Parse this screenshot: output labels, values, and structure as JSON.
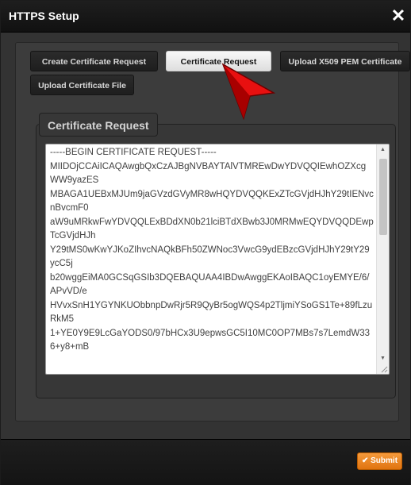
{
  "dialog": {
    "title": "HTTPS Setup",
    "close_glyph": "✕"
  },
  "tabs": [
    {
      "label": "Create Certificate Request",
      "active": false
    },
    {
      "label": "Certificate Request",
      "active": true
    },
    {
      "label": "Upload X509 PEM Certificate",
      "active": false
    },
    {
      "label": "Upload Certificate File",
      "active": false
    }
  ],
  "panel": {
    "title": "Certificate Request",
    "certificate_text": "-----BEGIN CERTIFICATE REQUEST-----\nMIIDOjCCAiICAQAwgbQxCzAJBgNVBAYTAlVTMREwDwYDVQQIEwhOZXcgWW9yazES\nMBAGA1UEBxMJUm9jaGVzdGVyMR8wHQYDVQQKExZTcGVjdHJhY29tIENvcnBvcmF0\naW9uMRkwFwYDVQQLExBDdXN0b21lciBTdXBwb3J0MRMwEQYDVQQDEwpTcGVjdHJh\nY29tMS0wKwYJKoZIhvcNAQkBFh50ZWNoc3VwcG9ydEBzcGVjdHJhY29tY29ycC5j\nb20wggEiMA0GCSqGSIb3DQEBAQUAA4IBDwAwggEKAoIBAQC1oyEMYE/6/APvVD/e\nHVvxSnH1YGYNKUObbnpDwRjr5R9QyBr5ogWQS4p2TljmiYSoGS1Te+89fLzuRkM5\n1+YE0Y9E9LcGaYODS0/97bHCx3U9epwsGC5I10MC0OP7MBs7s7LemdW336+y8+mB"
  },
  "scrollbar": {
    "position_fraction": 0.0,
    "up_icon": "scroll-up-arrow-icon",
    "down_icon": "scroll-down-arrow-icon"
  },
  "footer": {
    "submit_label": "Submit",
    "submit_icon": "checkmark-icon",
    "submit_color": "#f08a24"
  },
  "annotation": {
    "pointer_color": "#cc0000",
    "pointer_icon": "red-arrow-pointer-icon"
  }
}
